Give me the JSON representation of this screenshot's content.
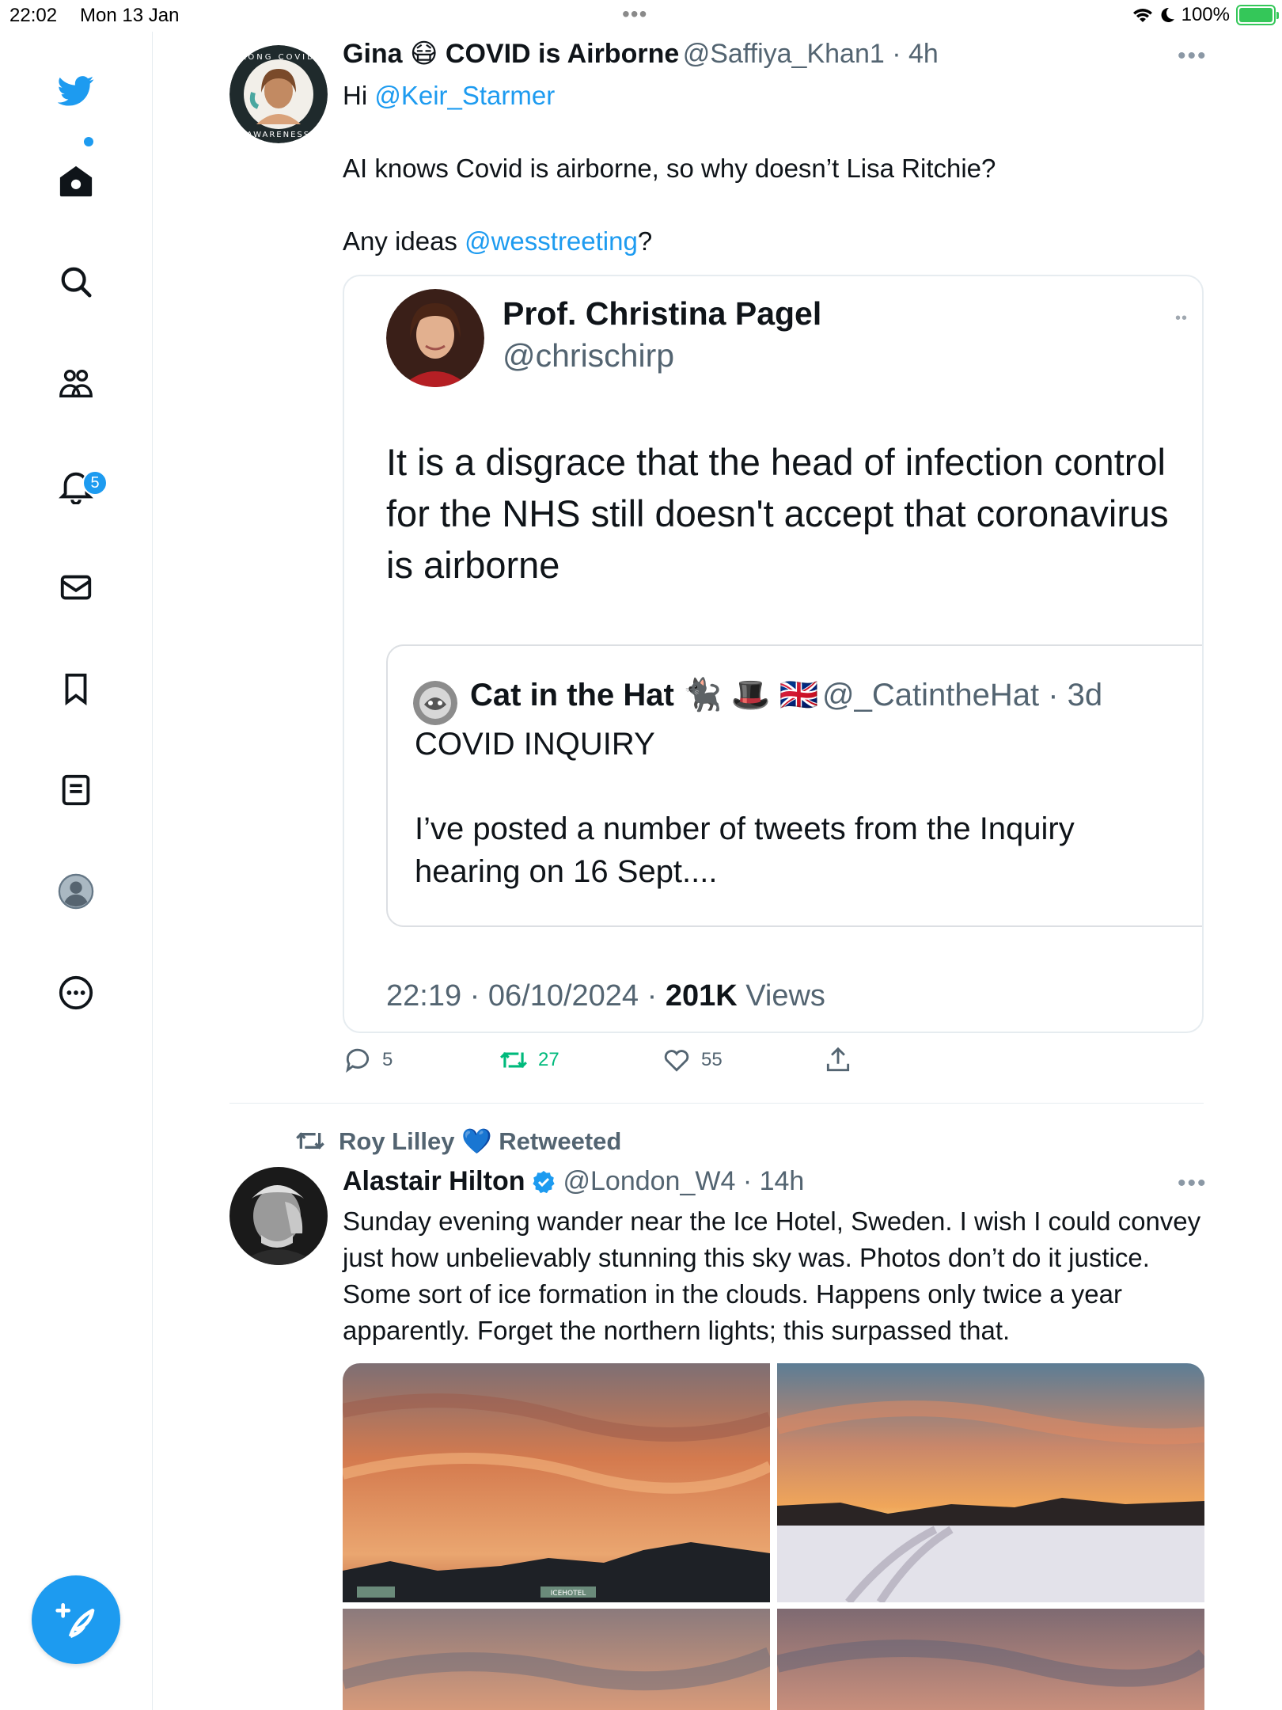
{
  "status_bar": {
    "time": "22:02",
    "date": "Mon 13 Jan",
    "battery": "100%"
  },
  "sidebar": {
    "notifications_badge": "5"
  },
  "tweet1": {
    "display_name": "Gina 😷 COVID is Airborne",
    "handle": "@Saffiya_Khan1",
    "age": "4h",
    "line1_prefix": "Hi ",
    "line1_mention": "@Keir_Starmer",
    "line2": "AI knows Covid is airborne, so why doesn’t Lisa Ritchie?",
    "line3_prefix": "Any ideas ",
    "line3_mention": "@wesstreeting",
    "line3_suffix": "?",
    "avatar_ring_top": "LONG COVID",
    "avatar_ring_bottom": "AWARENESS",
    "quote": {
      "display_name": "Prof. Christina Pagel",
      "handle": "@chrischirp",
      "text": "It is a disgrace that the head of infection control for the NHS still doesn't accept that coronavirus is airborne",
      "inner": {
        "display_name": "Cat in the Hat 🐈‍⬛ 🎩 🇬🇧",
        "handle": "@_CatintheHat",
        "age": "3d",
        "line1": "COVID INQUIRY",
        "line2": "I’ve posted a number of tweets from the Inquiry hearing on 16 Sept...."
      },
      "timestamp": "22:19 · 06/10/2024 · ",
      "views_count": "201K",
      "views_label": " Views"
    },
    "replies": "5",
    "retweets": "27",
    "likes": "55"
  },
  "tweet2": {
    "retweeted_by": "Roy Lilley 💙",
    "retweeted_label": "Retweeted",
    "display_name": "Alastair Hilton",
    "handle": "@London_W4",
    "age": "14h",
    "text": "Sunday evening wander near the Ice Hotel, Sweden. I wish I could convey just how unbelievably stunning this sky was. Photos don’t do it justice. Some sort of ice formation in the clouds. Happens only twice a year apparently. Forget the northern lights; this surpassed that.",
    "photo1_sign": "ICEHOTEL"
  },
  "colors": {
    "accent": "#1d9bf0",
    "retweet_green": "#00ba7c",
    "text_secondary": "#536471",
    "border": "#e6ecf0"
  }
}
